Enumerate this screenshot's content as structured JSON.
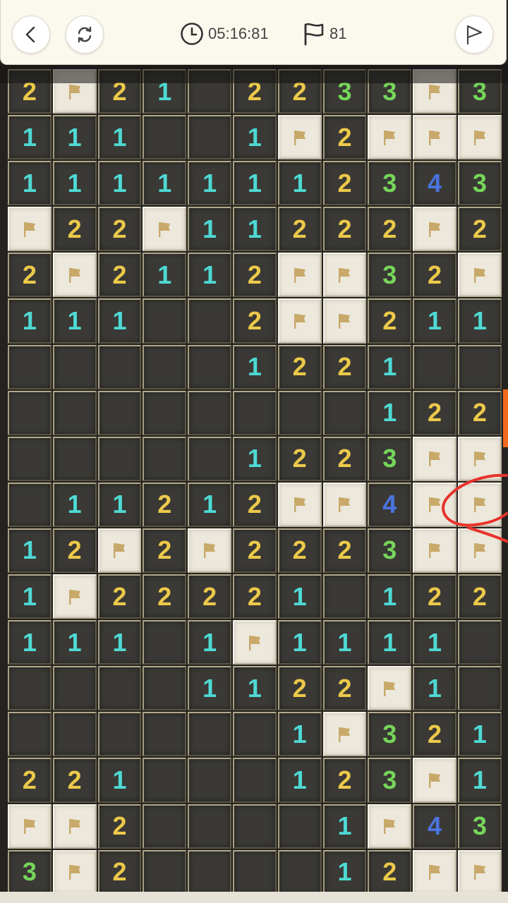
{
  "header": {
    "timer": "05:16:81",
    "flag_count": "81",
    "buttons": {
      "back_icon": "chevron-left-icon",
      "restart_icon": "restart-icon",
      "finish_icon": "flag-outline-icon"
    }
  },
  "colors": {
    "1": "#4fd9d4",
    "2": "#ecc94a",
    "3": "#76d65a",
    "4": "#4a74e0",
    "flag": "#c8a96a"
  },
  "board": {
    "columns": 11,
    "rows": [
      [
        "2",
        "F",
        "2",
        "1",
        "",
        "2",
        "2",
        "3",
        "3",
        "F",
        "3"
      ],
      [
        "1",
        "1",
        "1",
        "",
        "",
        "1",
        "F",
        "2",
        "F",
        "F",
        "F"
      ],
      [
        "1",
        "1",
        "1",
        "1",
        "1",
        "1",
        "1",
        "2",
        "3",
        "4",
        "3"
      ],
      [
        "F",
        "2",
        "2",
        "F",
        "1",
        "1",
        "2",
        "2",
        "2",
        "F",
        "2"
      ],
      [
        "2",
        "F",
        "2",
        "1",
        "1",
        "2",
        "F",
        "F",
        "3",
        "2",
        "F"
      ],
      [
        "1",
        "1",
        "1",
        "",
        "",
        "2",
        "F",
        "F",
        "2",
        "1",
        "1"
      ],
      [
        "",
        "",
        "",
        "",
        "",
        "1",
        "2",
        "2",
        "1",
        "",
        ""
      ],
      [
        "",
        "",
        "",
        "",
        "",
        "",
        "",
        "",
        "1",
        "2",
        "2"
      ],
      [
        "",
        "",
        "",
        "",
        "",
        "1",
        "2",
        "2",
        "3",
        "F",
        "F"
      ],
      [
        "",
        "1",
        "1",
        "2",
        "1",
        "2",
        "F",
        "F",
        "4",
        "F",
        "F"
      ],
      [
        "1",
        "2",
        "F",
        "2",
        "F",
        "2",
        "2",
        "2",
        "3",
        "F",
        "F"
      ],
      [
        "1",
        "F",
        "2",
        "2",
        "2",
        "2",
        "1",
        "",
        "1",
        "2",
        "2"
      ],
      [
        "1",
        "1",
        "1",
        "",
        "1",
        "F",
        "1",
        "1",
        "1",
        "1",
        ""
      ],
      [
        "",
        "",
        "",
        "",
        "1",
        "1",
        "2",
        "2",
        "F",
        "1",
        ""
      ],
      [
        "",
        "",
        "",
        "",
        "",
        "",
        "1",
        "F",
        "3",
        "2",
        "1"
      ],
      [
        "2",
        "2",
        "1",
        "",
        "",
        "",
        "1",
        "2",
        "3",
        "F",
        "1"
      ],
      [
        "F",
        "F",
        "2",
        "",
        "",
        "",
        "",
        "1",
        "F",
        "4",
        "3"
      ],
      [
        "3",
        "F",
        "2",
        "",
        "",
        "",
        "",
        "1",
        "2",
        "F",
        "F"
      ]
    ]
  }
}
